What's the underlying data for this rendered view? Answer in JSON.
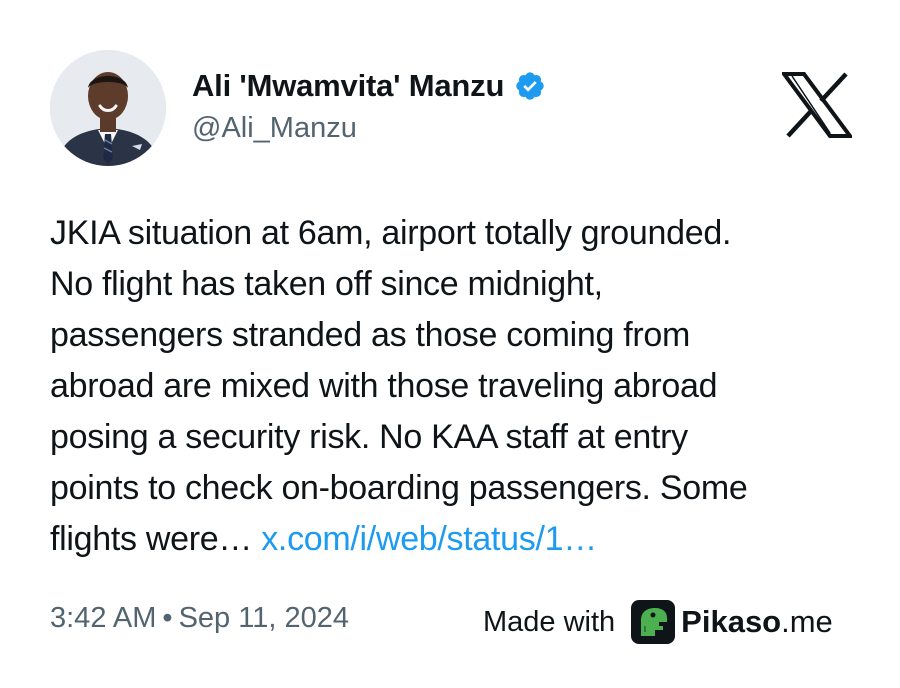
{
  "author": {
    "display_name": "Ali 'Mwamvita' Manzu",
    "handle": "@Ali_Manzu",
    "verified": true,
    "avatar_icon": "profile-photo-man-in-suit"
  },
  "platform_icon": "x-logo-icon",
  "tweet": {
    "lines": [
      "JKIA situation at 6am, airport totally grounded.",
      "No flight has taken off since midnight,",
      "passengers stranded as those coming from",
      "abroad are mixed with those traveling abroad",
      "posing a security risk. No KAA staff at entry",
      "points to check on-boarding passengers. Some"
    ],
    "last_line_text": "flights were… ",
    "link_text": "x.com/i/web/status/1…"
  },
  "meta": {
    "time": "3:42 AM",
    "separator": "•",
    "date": "Sep 11, 2024"
  },
  "footer": {
    "made_with_label": "Made with",
    "brand_bold": "Pikaso",
    "brand_suffix": ".me"
  },
  "colors": {
    "text_primary": "#0f1419",
    "text_secondary": "#536471",
    "link": "#1d9bf0",
    "verified_badge": "#1d9bf0",
    "pikaso_green": "#4caf50"
  }
}
